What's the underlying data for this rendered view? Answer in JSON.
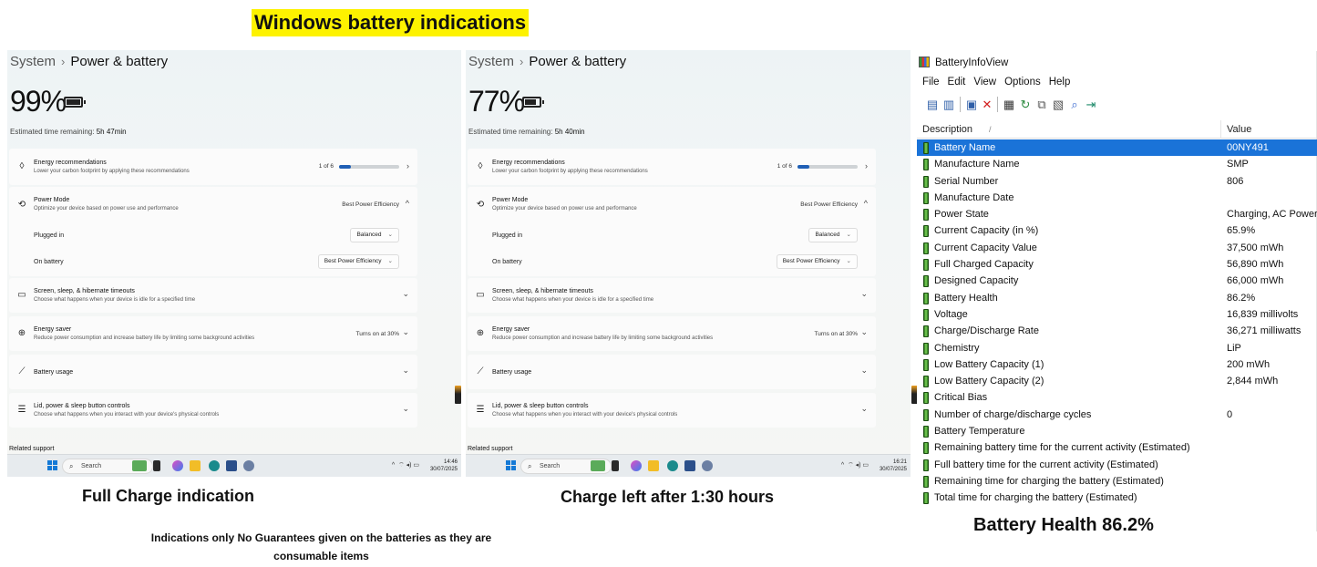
{
  "banner": "Windows battery indications",
  "settings": {
    "crumb_system": "System",
    "crumb_sep": "›",
    "crumb_current": "Power & battery",
    "energy_title": "Energy recommendations",
    "energy_sub": "Lower your carbon footprint by applying these recommendations",
    "energy_count": "1 of 6",
    "energy_progress": 0.2,
    "power_mode_title": "Power Mode",
    "power_mode_sub": "Optimize your device based on power use and performance",
    "power_mode_value": "Best Power Efficiency",
    "plugged_in_label": "Plugged in",
    "plugged_in_value": "Balanced",
    "on_battery_label": "On battery",
    "on_battery_value": "Best Power Efficiency",
    "screen_title": "Screen, sleep, & hibernate timeouts",
    "screen_sub": "Choose what happens when your device is idle for a specified time",
    "saver_title": "Energy saver",
    "saver_sub": "Reduce power consumption and increase battery life by limiting some background activities",
    "saver_value": "Turns on at 30%",
    "usage_title": "Battery usage",
    "lid_title": "Lid, power & sleep button controls",
    "lid_sub": "Choose what happens when you interact with your device's physical controls",
    "related": "Related support",
    "search_label": "Search",
    "est_label": "Estimated time remaining:",
    "date": "30/07/2025"
  },
  "screens": [
    {
      "percent": "99%",
      "level": 0.99,
      "est_time": "5h 47min",
      "clock": "14:46"
    },
    {
      "percent": "77%",
      "level": 0.77,
      "est_time": "5h 40min",
      "clock": "16:21"
    }
  ],
  "batteryinfo": {
    "title": "BatteryInfoView",
    "menu": [
      "File",
      "Edit",
      "View",
      "Options",
      "Help"
    ],
    "col_description": "Description",
    "col_value": "Value",
    "rows": [
      {
        "d": "Battery Name",
        "v": "00NY491"
      },
      {
        "d": "Manufacture Name",
        "v": "SMP"
      },
      {
        "d": "Serial Number",
        "v": "806"
      },
      {
        "d": "Manufacture Date",
        "v": ""
      },
      {
        "d": "Power State",
        "v": "Charging, AC Power"
      },
      {
        "d": "Current Capacity (in %)",
        "v": "65.9%"
      },
      {
        "d": "Current Capacity Value",
        "v": "37,500 mWh"
      },
      {
        "d": "Full Charged Capacity",
        "v": "56,890 mWh"
      },
      {
        "d": "Designed Capacity",
        "v": "66,000 mWh"
      },
      {
        "d": "Battery Health",
        "v": "86.2%"
      },
      {
        "d": "Voltage",
        "v": "16,839 millivolts"
      },
      {
        "d": "Charge/Discharge Rate",
        "v": "36,271 milliwatts"
      },
      {
        "d": "Chemistry",
        "v": "LiP"
      },
      {
        "d": "Low Battery Capacity (1)",
        "v": "200 mWh"
      },
      {
        "d": "Low Battery Capacity (2)",
        "v": "2,844 mWh"
      },
      {
        "d": "Critical Bias",
        "v": ""
      },
      {
        "d": "Number of charge/discharge cycles",
        "v": "0"
      },
      {
        "d": "Battery Temperature",
        "v": ""
      },
      {
        "d": "Remaining battery time for the current activity (Estimated)",
        "v": ""
      },
      {
        "d": "Full battery time for the current activity (Estimated)",
        "v": ""
      },
      {
        "d": "Remaining time for charging the battery (Estimated)",
        "v": ""
      },
      {
        "d": "Total  time for charging the battery (Estimated)",
        "v": ""
      }
    ]
  },
  "captions": {
    "full_charge": "Full Charge indication",
    "charge_left": "Charge left after 1:30 hours",
    "battery_health": "Battery Health 86.2%",
    "note": "Indications only No Guarantees given on the batteries as they are consumable items"
  }
}
